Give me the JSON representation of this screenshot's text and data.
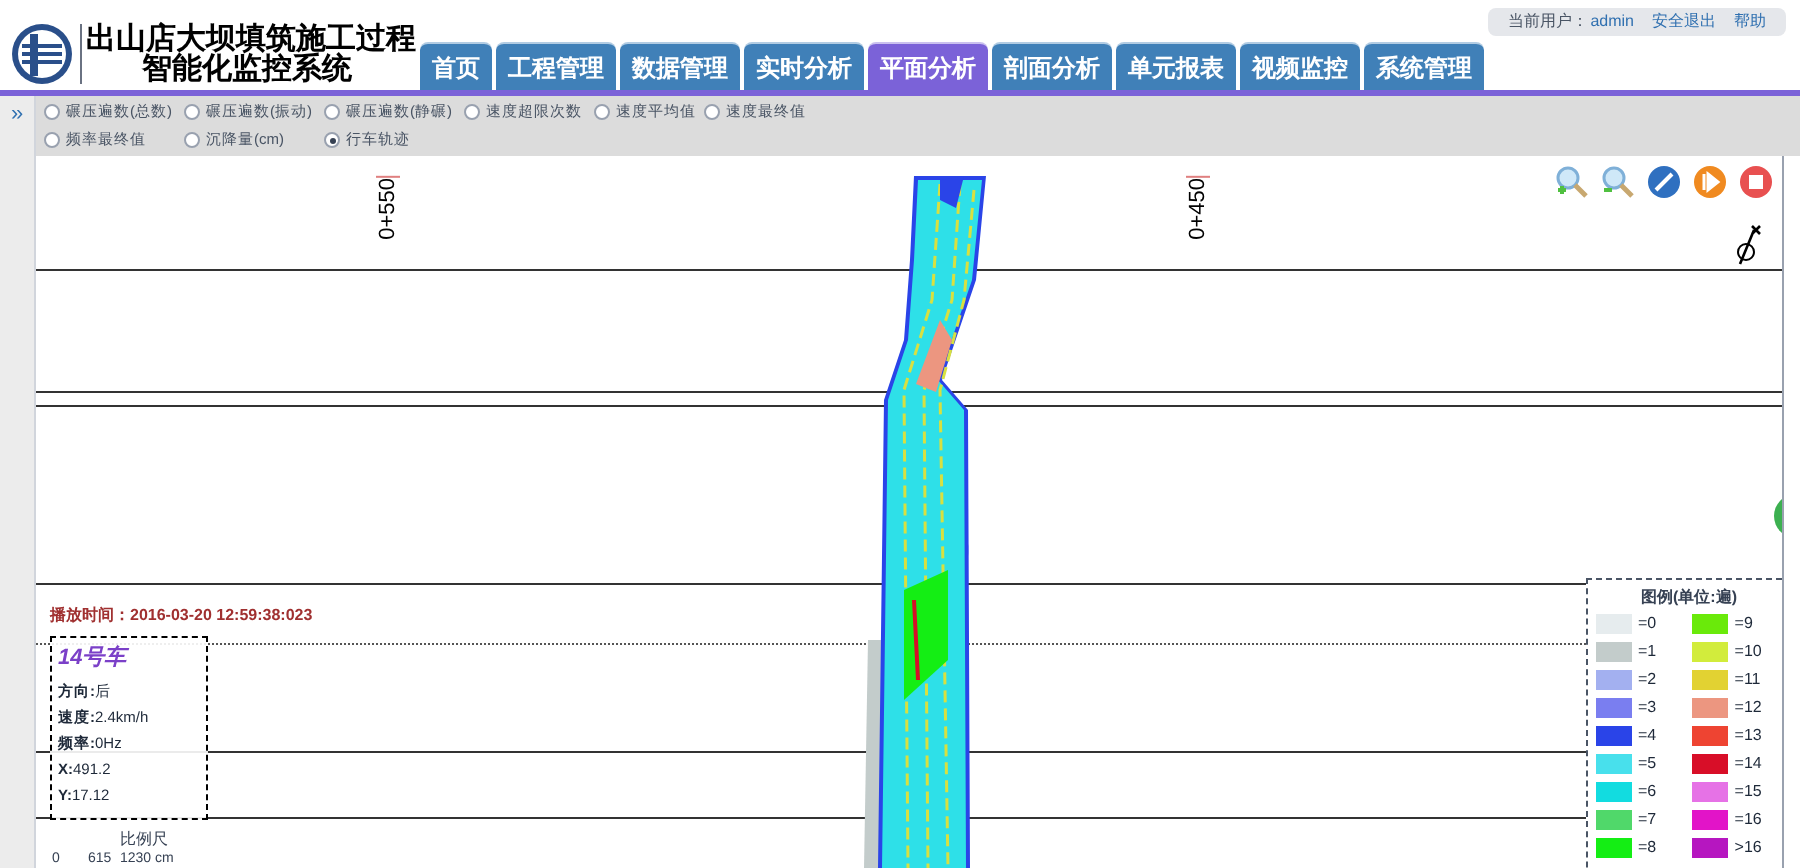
{
  "header": {
    "title_line1": "出山店大坝填筑施工过程",
    "title_line2": "智能化监控系统",
    "user_label": "当前用户：",
    "user": "admin",
    "logout": "安全退出",
    "help": "帮助"
  },
  "tabs": [
    {
      "label": "首页",
      "selected": false
    },
    {
      "label": "工程管理",
      "selected": false
    },
    {
      "label": "数据管理",
      "selected": false
    },
    {
      "label": "实时分析",
      "selected": false
    },
    {
      "label": "平面分析",
      "selected": true
    },
    {
      "label": "剖面分析",
      "selected": false
    },
    {
      "label": "单元报表",
      "selected": false
    },
    {
      "label": "视频监控",
      "selected": false
    },
    {
      "label": "系统管理",
      "selected": false
    }
  ],
  "sidebar_toggle": "»",
  "options": [
    [
      {
        "label": "碾压遍数(总数)",
        "selected": false
      },
      {
        "label": "碾压遍数(振动)",
        "selected": false
      },
      {
        "label": "碾压遍数(静碾)",
        "selected": false
      },
      {
        "label": "速度超限次数",
        "selected": false
      },
      {
        "label": "速度平均值",
        "selected": false
      },
      {
        "label": "速度最终值",
        "selected": false
      }
    ],
    [
      {
        "label": "频率最终值",
        "selected": false
      },
      {
        "label": "沉降量(cm)",
        "selected": false
      },
      {
        "label": "行车轨迹",
        "selected": true
      }
    ]
  ],
  "stations": [
    "0+550",
    "0+450"
  ],
  "play_time": "播放时间：2016-03-20 12:59:38:023",
  "vehicle": {
    "name": "14号车",
    "lines": [
      "**方向:**后",
      "**速度:**2.4km/h",
      "**频率:**0Hz",
      "**X:**491.2",
      "**Y:**17.12"
    ]
  },
  "scale": {
    "label": "比例尺",
    "ticks": [
      "0",
      "615",
      "1230 cm"
    ]
  },
  "legend": {
    "title": "图例(单位:遍)",
    "items": [
      {
        "label": "=0",
        "color": "#e6ecee"
      },
      {
        "label": "=1",
        "color": "#c3cccb"
      },
      {
        "label": "=2",
        "color": "#a3b0f0"
      },
      {
        "label": "=3",
        "color": "#7a7ef0"
      },
      {
        "label": "=4",
        "color": "#2a44e8"
      },
      {
        "label": "=5",
        "color": "#48e0ec"
      },
      {
        "label": "=6",
        "color": "#12dce0"
      },
      {
        "label": "=7",
        "color": "#50d86a"
      },
      {
        "label": "=8",
        "color": "#14ee14"
      },
      {
        "label": "=9",
        "color": "#6aea0a"
      },
      {
        "label": "=10",
        "color": "#d2ec3c"
      },
      {
        "label": "=11",
        "color": "#e2d232"
      },
      {
        "label": "=12",
        "color": "#ec9680"
      },
      {
        "label": "=13",
        "color": "#ee4432"
      },
      {
        "label": "=14",
        "color": "#d80e28"
      },
      {
        "label": "=15",
        "color": "#e672e6"
      },
      {
        "label": "=16",
        "color": "#e214c8"
      },
      {
        "label": ">16",
        "color": "#b616c0"
      }
    ]
  }
}
